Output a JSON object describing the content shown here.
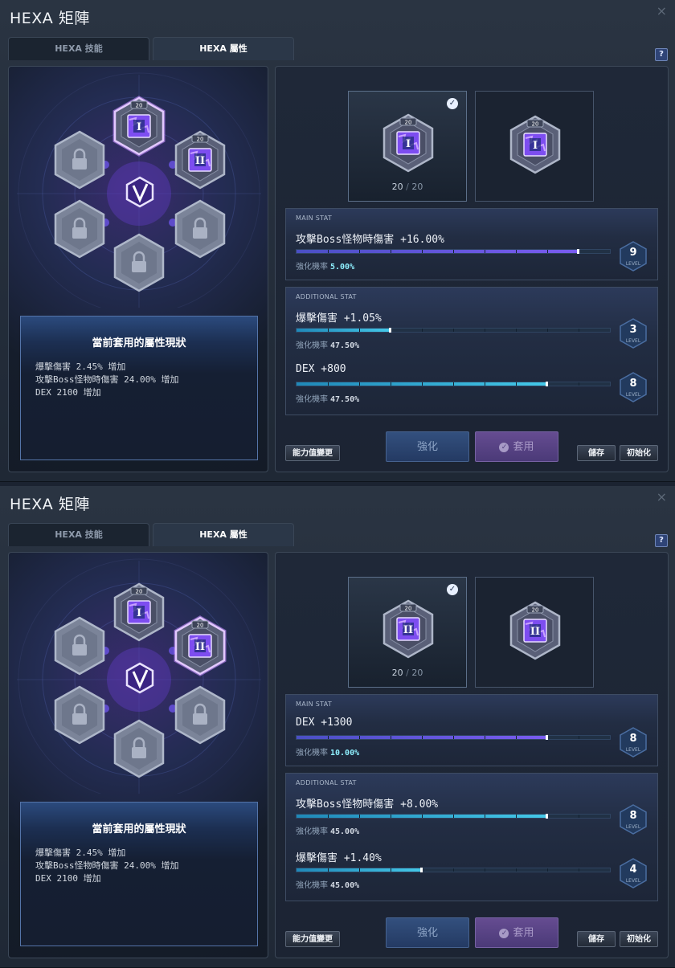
{
  "panels": [
    {
      "window": {
        "title": "HEXA 矩陣",
        "close_icon": "×",
        "help_label": "?"
      },
      "tabs": [
        {
          "label": "HEXA 技能"
        },
        {
          "label": "HEXA 屬性"
        }
      ],
      "matrix": {
        "selected_core": "I",
        "cores": [
          {
            "level": "20",
            "roman": "I"
          },
          {
            "level": "20",
            "roman": "II"
          }
        ]
      },
      "status": {
        "title": "當前套用的屬性現狀",
        "lines": [
          "爆擊傷害 2.45% 增加",
          "攻擊Boss怪物時傷害 24.00% 增加",
          "DEX 2100 增加"
        ]
      },
      "slots": [
        {
          "level": "20",
          "roman": "I",
          "count": "20",
          "sep": "/",
          "max": "20",
          "checked": true
        },
        {
          "level": "20",
          "roman": "I"
        }
      ],
      "main_stat": {
        "caption": "MAIN STAT",
        "name": "攻擊Boss怪物時傷害 +16.00%",
        "rate_label": "強化機率",
        "rate": "5.00%",
        "level": "9",
        "level_label": "LEVEL",
        "progress": 0.9
      },
      "additional_stat": {
        "caption": "ADDITIONAL STAT",
        "stats": [
          {
            "name": "爆擊傷害 +1.05%",
            "rate_label": "強化機率",
            "rate": "47.50%",
            "level": "3",
            "level_label": "LEVEL",
            "progress": 0.3
          },
          {
            "name": "DEX +800",
            "rate_label": "強化機率",
            "rate": "47.50%",
            "level": "8",
            "level_label": "LEVEL",
            "progress": 0.8
          }
        ]
      },
      "buttons": {
        "change": "能力值變更",
        "enhance": "強化",
        "apply": "套用",
        "save": "儲存",
        "reset": "初始化"
      }
    },
    {
      "window": {
        "title": "HEXA 矩陣",
        "close_icon": "×",
        "help_label": "?"
      },
      "tabs": [
        {
          "label": "HEXA 技能"
        },
        {
          "label": "HEXA 屬性"
        }
      ],
      "matrix": {
        "selected_core": "II",
        "cores": [
          {
            "level": "20",
            "roman": "I"
          },
          {
            "level": "20",
            "roman": "II"
          }
        ]
      },
      "status": {
        "title": "當前套用的屬性現狀",
        "lines": [
          "爆擊傷害 2.45% 增加",
          "攻擊Boss怪物時傷害 24.00% 增加",
          "DEX 2100 增加"
        ]
      },
      "slots": [
        {
          "level": "20",
          "roman": "II",
          "count": "20",
          "sep": "/",
          "max": "20",
          "checked": true
        },
        {
          "level": "20",
          "roman": "II"
        }
      ],
      "main_stat": {
        "caption": "MAIN STAT",
        "name": "DEX +1300",
        "rate_label": "強化機率",
        "rate": "10.00%",
        "level": "8",
        "level_label": "LEVEL",
        "progress": 0.8
      },
      "additional_stat": {
        "caption": "ADDITIONAL STAT",
        "stats": [
          {
            "name": "攻擊Boss怪物時傷害 +8.00%",
            "rate_label": "強化機率",
            "rate": "45.00%",
            "level": "8",
            "level_label": "LEVEL",
            "progress": 0.8
          },
          {
            "name": "爆擊傷害 +1.40%",
            "rate_label": "強化機率",
            "rate": "45.00%",
            "level": "4",
            "level_label": "LEVEL",
            "progress": 0.4
          }
        ]
      },
      "buttons": {
        "change": "能力值變更",
        "enhance": "強化",
        "apply": "套用",
        "save": "儲存",
        "reset": "初始化"
      }
    }
  ]
}
